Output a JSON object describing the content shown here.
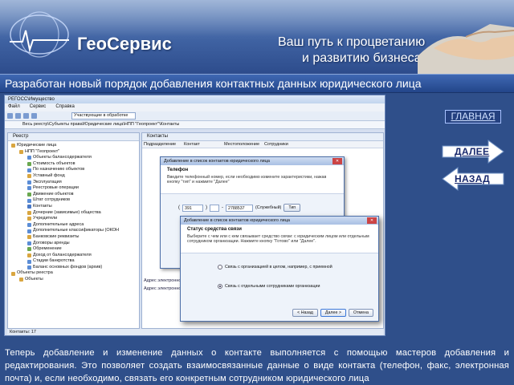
{
  "banner": {
    "brand": "ГеоСервис",
    "slogan_line1": "Ваш путь к процветанию",
    "slogan_line2": "и развитию бизнеса!"
  },
  "headline": "Разработан новый порядок добавления контактных данных юридического лица",
  "nav": {
    "home": "ГЛАВНАЯ",
    "next": "ДАЛЕЕ",
    "back": "НАЗАД"
  },
  "body_text": "Теперь добавление и изменение данных о контакте выполняется с помощью мастеров добавления и редактирования. Это позволяет создать взаимосвязанные данные о виде контакта (телефон, факс, электронная почта) и, если необходимо, связать его конкретным сотрудником юридического лица",
  "screenshot": {
    "app_title": "РЕГОСС\\Имущество",
    "menu": [
      "Файл",
      "Сервис",
      "Справка"
    ],
    "filter_combo": "Участвующие в обработке",
    "address": "Весь реестр\\Субъекты права\\Юридические лица\\НПП \"Геопроект\"\\Контакты",
    "left_tab": "Реестр",
    "tree": [
      "Юридические лица",
      "НПП \"Геопроект\"",
      "Объекты балансодержателя",
      "Стоимость объектов",
      "По назначению объектов",
      "Уставный фонд",
      "Эксплуатация",
      "Реестровые операции",
      "Движение объектов",
      "Штат сотрудников",
      "Контакты",
      "Дочерние (зависимые) общества",
      "Учредители",
      "Дополнительные адреса",
      "Дополнительные классификаторы (ОКОН",
      "Банковские реквизиты",
      "Договоры аренды",
      "Обременение",
      "Доход от балансодержателя",
      "Стадии банкротства",
      "Баланс основных фондов (архив)",
      "Объекты реестра",
      "Объекты"
    ],
    "right_tab": "Контакты",
    "columns": [
      "Подразделение",
      "Контакт",
      "Местоположение",
      "Сотрудники"
    ],
    "row_label": "Адрес электронной почты",
    "status": "Контакты: 17",
    "dialog1": {
      "title": "Добавление в список контактов юридического лица",
      "heading": "Телефон",
      "hint": "Введите телефонный номер, если необходимо измените характеристики, нажав кнопку \"тип\" и нажмите \"Далее\"",
      "code": "391",
      "number": "2788537",
      "kind": "(Служебный)",
      "type_button": "Тип"
    },
    "dialog2": {
      "title": "Добавление в список контактов юридического лица",
      "heading": "Статус средства связи",
      "hint": "Выберите с чем или с кем связывает средство связи: с юридическим лицом или отдельным сотрудником организации. Нажмите кнопку \"Готово\" или \"Далее\".",
      "option1": "Связь с организацией в целом, например, с приемной",
      "option2": "Связь с отдельными сотрудниками организации",
      "back": "< Назад",
      "next": "Далее >",
      "cancel": "Отмена"
    }
  }
}
